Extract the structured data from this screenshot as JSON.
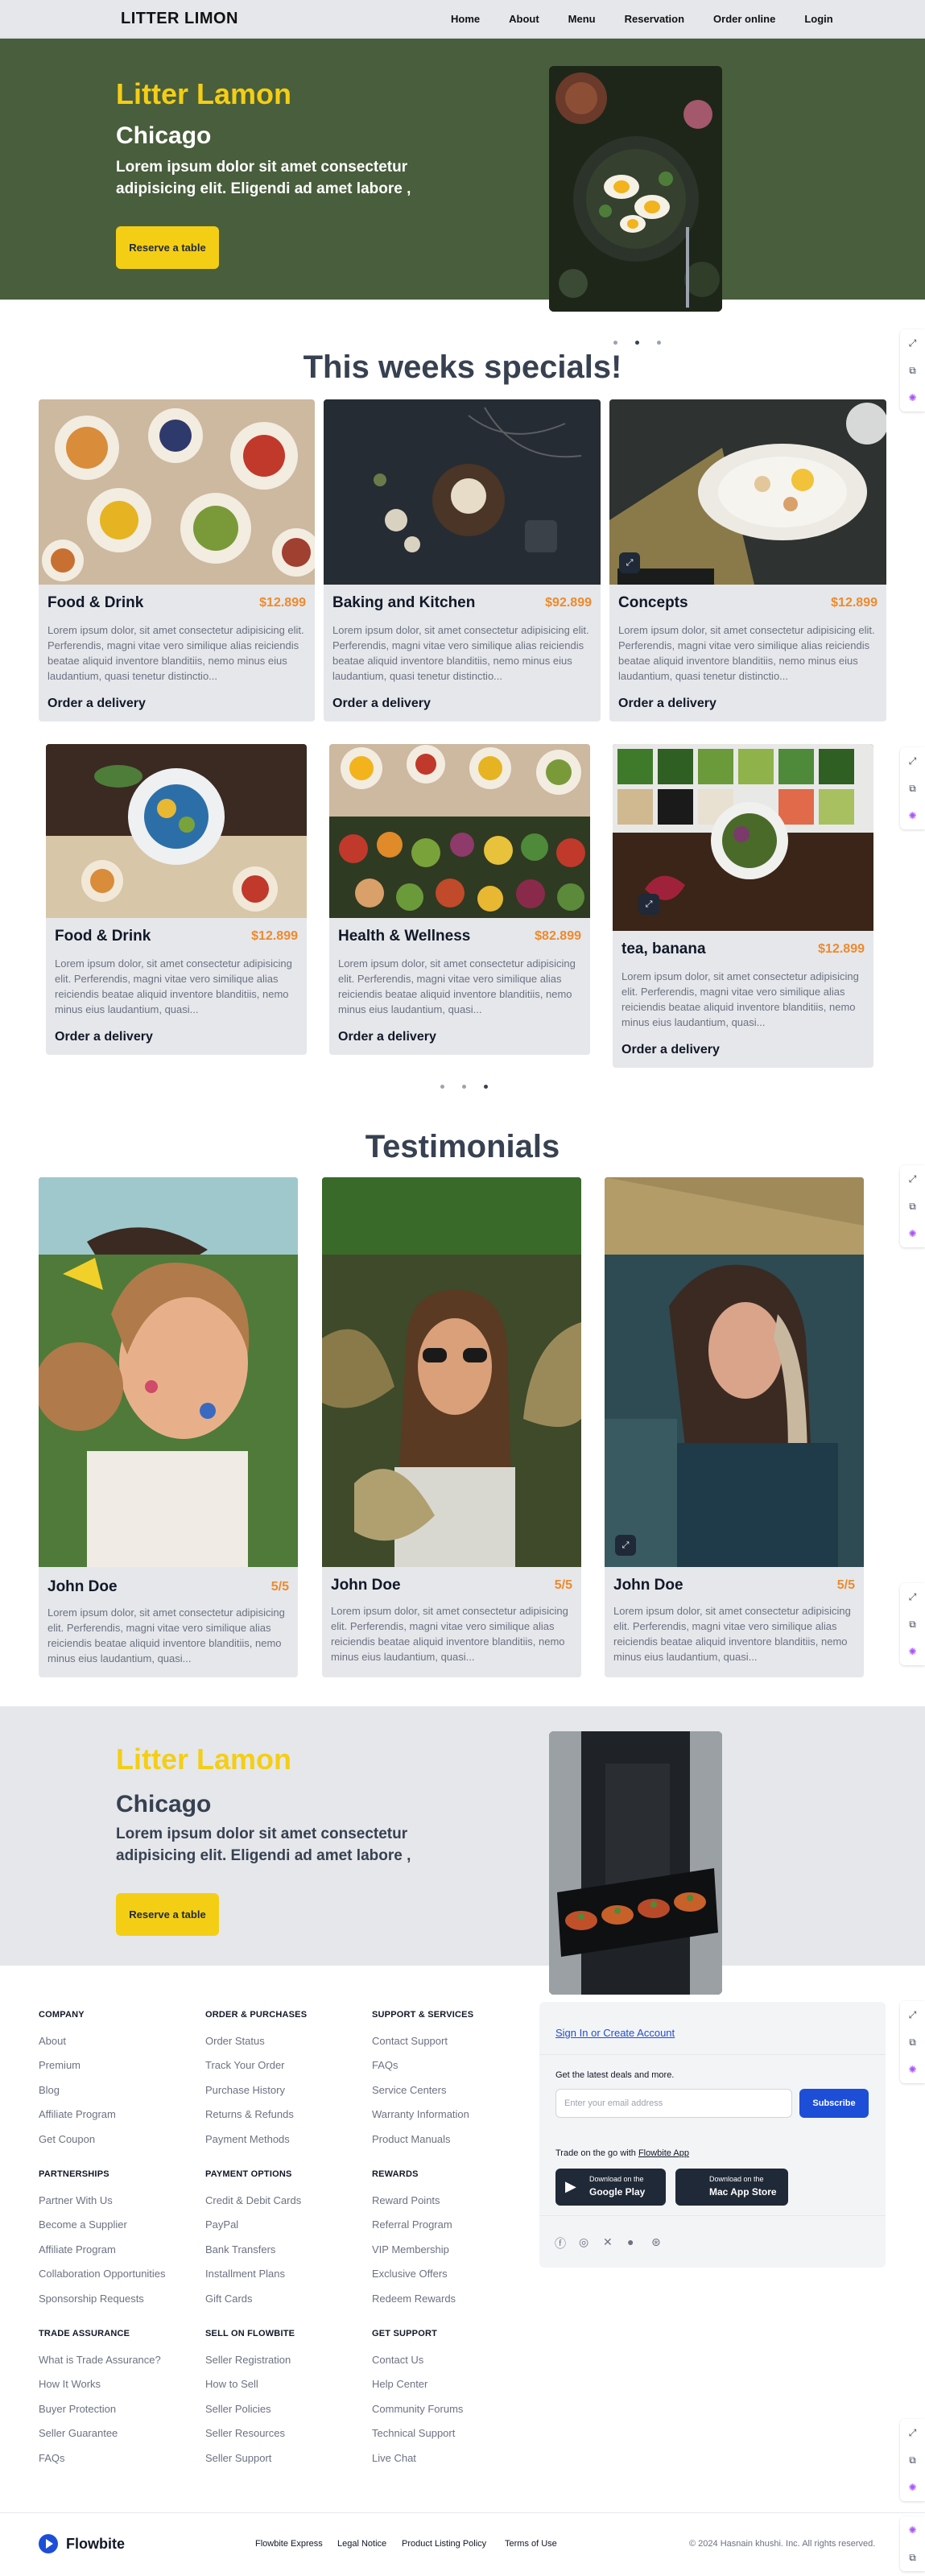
{
  "nav": {
    "brand": "LITTER LIMON",
    "links": [
      "Home",
      "About",
      "Menu",
      "Reservation",
      "Order online",
      "Login"
    ]
  },
  "hero": {
    "title": "Litter Lamon",
    "city": "Chicago",
    "description": "Lorem ipsum dolor sit amet consectetur adipisicing elit. Eligendi ad amet labore ,",
    "button": "Reserve a table"
  },
  "specials": {
    "title": "This weeks specials!",
    "row1": [
      {
        "name": "Food & Drink",
        "price": "$12.899",
        "description": "Lorem ipsum dolor, sit amet consectetur adipisicing elit. Perferendis, magni vitae vero similique alias reiciendis beatae aliquid inventore blanditiis, nemo minus eius laudantium, quasi tenetur distinctio...",
        "link": "Order a delivery"
      },
      {
        "name": "Baking and Kitchen",
        "price": "$92.899",
        "description": "Lorem ipsum dolor, sit amet consectetur adipisicing elit. Perferendis, magni vitae vero similique alias reiciendis beatae aliquid inventore blanditiis, nemo minus eius laudantium, quasi tenetur distinctio...",
        "link": "Order a delivery"
      },
      {
        "name": "Concepts",
        "price": "$12.899",
        "description": "Lorem ipsum dolor, sit amet consectetur adipisicing elit. Perferendis, magni vitae vero similique alias reiciendis beatae aliquid inventore blanditiis, nemo minus eius laudantium, quasi tenetur distinctio...",
        "link": "Order a delivery"
      }
    ],
    "row2": [
      {
        "name": "Food & Drink",
        "price": "$12.899",
        "description": "Lorem ipsum dolor, sit amet consectetur adipisicing elit. Perferendis, magni vitae vero similique alias reiciendis beatae aliquid inventore blanditiis, nemo minus eius laudantium, quasi...",
        "link": "Order a delivery"
      },
      {
        "name": "Health & Wellness",
        "price": "$82.899",
        "description": "Lorem ipsum dolor, sit amet consectetur adipisicing elit. Perferendis, magni vitae vero similique alias reiciendis beatae aliquid inventore blanditiis, nemo minus eius laudantium, quasi...",
        "link": "Order a delivery"
      },
      {
        "name": "tea, banana",
        "price": "$12.899",
        "description": "Lorem ipsum dolor, sit amet consectetur adipisicing elit. Perferendis, magni vitae vero similique alias reiciendis beatae aliquid inventore blanditiis, nemo minus eius laudantium, quasi...",
        "link": "Order a delivery"
      }
    ]
  },
  "testimonials": {
    "title": "Testimonials",
    "items": [
      {
        "name": "John Doe",
        "rating": "5/5",
        "description": "Lorem ipsum dolor, sit amet consectetur adipisicing elit. Perferendis, magni vitae vero similique alias reiciendis beatae aliquid inventore blanditiis, nemo minus eius laudantium, quasi..."
      },
      {
        "name": "John Doe",
        "rating": "5/5",
        "description": "Lorem ipsum dolor, sit amet consectetur adipisicing elit. Perferendis, magni vitae vero similique alias reiciendis beatae aliquid inventore blanditiis, nemo minus eius laudantium, quasi..."
      },
      {
        "name": "John Doe",
        "rating": "5/5",
        "description": "Lorem ipsum dolor, sit amet consectetur adipisicing elit. Perferendis, magni vitae vero similique alias reiciendis beatae aliquid inventore blanditiis, nemo minus eius laudantium, quasi..."
      }
    ]
  },
  "hero2": {
    "title": "Litter Lamon",
    "city": "Chicago",
    "description": "Lorem ipsum dolor sit amet consectetur adipisicing elit. Eligendi ad amet labore ,",
    "button": "Reserve a table"
  },
  "footer": {
    "columns": [
      {
        "title": "COMPANY",
        "links": [
          "About",
          "Premium",
          "Blog",
          "Affiliate Program",
          "Get Coupon"
        ]
      },
      {
        "title": "ORDER & PURCHASES",
        "links": [
          "Order Status",
          "Track Your Order",
          "Purchase History",
          "Returns & Refunds",
          "Payment Methods"
        ]
      },
      {
        "title": "SUPPORT & SERVICES",
        "links": [
          "Contact Support",
          "FAQs",
          "Service Centers",
          "Warranty Information",
          "Product Manuals"
        ]
      },
      {
        "title": "PARTNERSHIPS",
        "links": [
          "Partner With Us",
          "Become a Supplier",
          "Affiliate Program",
          "Collaboration Opportunities",
          "Sponsorship Requests"
        ]
      },
      {
        "title": "PAYMENT OPTIONS",
        "links": [
          "Credit & Debit Cards",
          "PayPal",
          "Bank Transfers",
          "Installment Plans",
          "Gift Cards"
        ]
      },
      {
        "title": "REWARDS",
        "links": [
          "Reward Points",
          "Referral Program",
          "VIP Membership",
          "Exclusive Offers",
          "Redeem Rewards"
        ]
      },
      {
        "title": "TRADE ASSURANCE",
        "links": [
          "What is Trade Assurance?",
          "How It Works",
          "Buyer Protection",
          "Seller Guarantee",
          "FAQs"
        ]
      },
      {
        "title": "SELL ON FLOWBITE",
        "links": [
          "Seller Registration",
          "How to Sell",
          "Seller Policies",
          "Seller Resources",
          "Seller Support"
        ]
      },
      {
        "title": "GET SUPPORT",
        "links": [
          "Contact Us",
          "Help Center",
          "Community Forums",
          "Technical Support",
          "Live Chat"
        ]
      }
    ],
    "signin": "Sign In or Create Account",
    "deals": "Get the latest deals and more.",
    "email_placeholder": "Enter your email address",
    "subscribe": "Subscribe",
    "trade_prefix": "Trade on the go with",
    "trade_link": "Flowbite App",
    "google_small": "Download on the",
    "google_big": "Google Play",
    "apple_small": "Download on the",
    "apple_big": "Mac App Store",
    "brand": "Flowbite",
    "bottom_links": [
      "Flowbite Express",
      "Legal Notice",
      "Product Listing Policy",
      "Terms of Use"
    ],
    "copyright": "© 2024 Hasnain khushi. Inc. All rights reserved."
  },
  "icons": {
    "side": [
      "expand-icon",
      "copy-icon",
      "ai-icon"
    ],
    "social": [
      "facebook-icon",
      "instagram-icon",
      "twitter-icon",
      "github-icon",
      "dribbble-icon"
    ]
  },
  "colors": {
    "hero_bg": "#495e3c",
    "accent_yellow": "#f4ce14",
    "price_orange": "#ee8a2c",
    "card_bg": "#e5e7eb",
    "subscribe_blue": "#1d4ed8"
  }
}
